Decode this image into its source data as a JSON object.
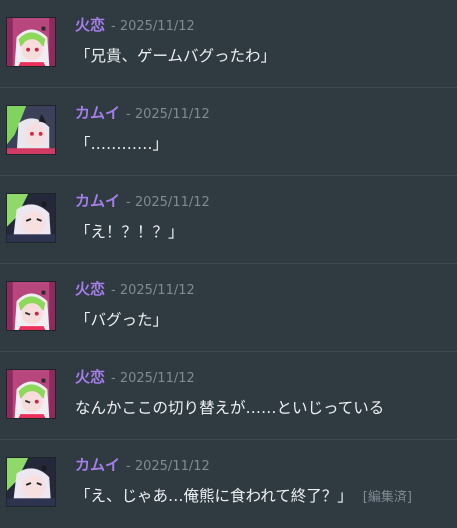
{
  "messages": [
    {
      "author": "火恋",
      "author_color": "#a47fea",
      "date": "- 2025/11/12",
      "text": "「兄貴、ゲームバグったわ」",
      "avatar": "karen"
    },
    {
      "author": "カムイ",
      "author_color": "#a47fea",
      "date": "- 2025/11/12",
      "text": "「…………」",
      "avatar": "kamui-a"
    },
    {
      "author": "カムイ",
      "author_color": "#a47fea",
      "date": "- 2025/11/12",
      "text": "「え！？！？」",
      "avatar": "kamui-b"
    },
    {
      "author": "火恋",
      "author_color": "#a47fea",
      "date": "- 2025/11/12",
      "text": "「バグった」",
      "avatar": "karen"
    },
    {
      "author": "火恋",
      "author_color": "#a47fea",
      "date": "- 2025/11/12",
      "text": "なんかここの切り替えが……といじっている",
      "avatar": "karen"
    },
    {
      "author": "カムイ",
      "author_color": "#a47fea",
      "date": "- 2025/11/12",
      "text": "「え、じゃあ…俺熊に食われて終了？」",
      "avatar": "kamui-b",
      "edited": "[編集済]"
    }
  ]
}
